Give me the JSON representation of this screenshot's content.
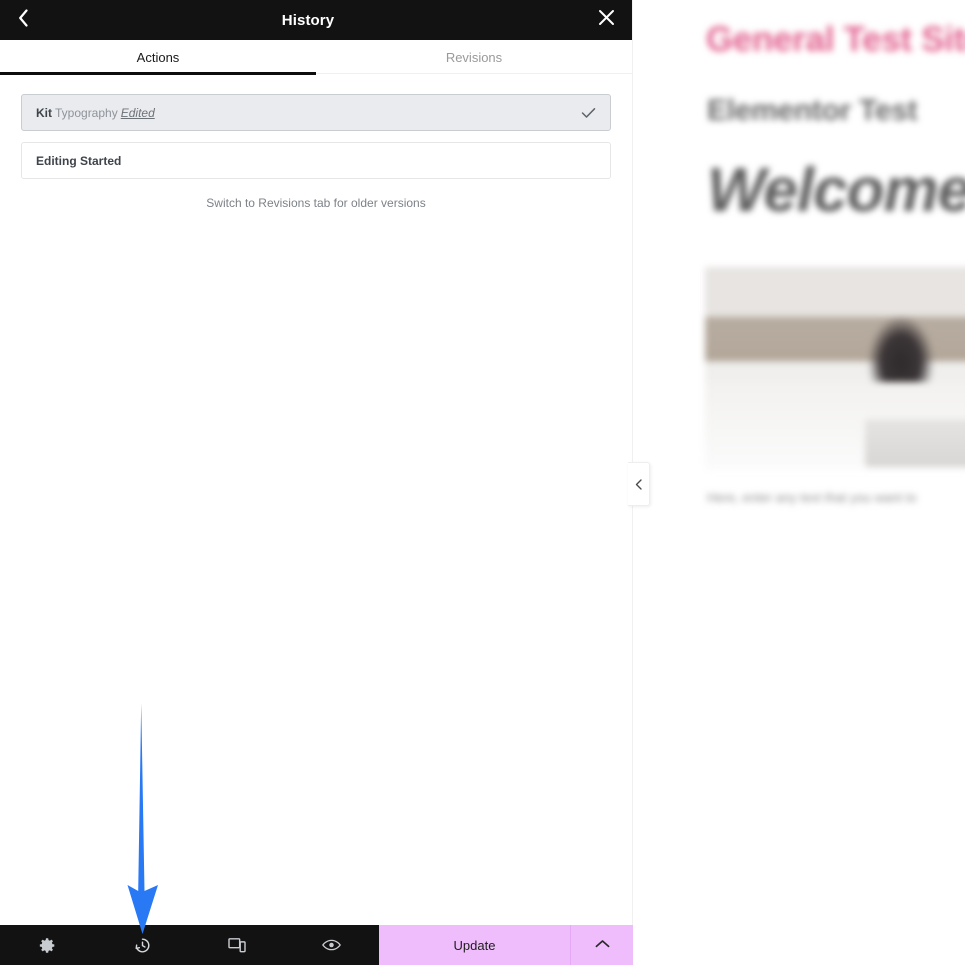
{
  "panel": {
    "title": "History",
    "back_icon": "chevron-left-icon",
    "close_icon": "close-icon",
    "tabs": [
      {
        "label": "Actions",
        "active": true
      },
      {
        "label": "Revisions",
        "active": false
      }
    ],
    "history_items": [
      {
        "title": "Kit",
        "subtitle": "Typography",
        "status": "Edited",
        "current": true,
        "check_icon": "check-icon"
      },
      {
        "title": "Editing Started",
        "subtitle": "",
        "status": "",
        "current": false,
        "check_icon": ""
      }
    ],
    "note": "Switch to Revisions tab for older versions"
  },
  "footer": {
    "tools": [
      {
        "name": "settings-icon"
      },
      {
        "name": "history-icon"
      },
      {
        "name": "responsive-mode-icon"
      },
      {
        "name": "preview-icon"
      }
    ],
    "update_label": "Update",
    "caret_icon": "chevron-up-icon"
  },
  "preview": {
    "site_title": "General Test Site",
    "sub_title": "Elementor Test",
    "welcome_heading": "Welcome",
    "body_text": "Here, enter any text that you want to",
    "collapse_icon": "chevron-left-icon"
  },
  "annotation": {
    "arrow": "down-arrow-pointer",
    "color": "#2979f5"
  },
  "colors": {
    "panel_header_bg": "#121212",
    "update_bg": "#efbdfb",
    "tab_active_underline": "#0d0d0d",
    "current_item_bg": "#e9ebee",
    "site_title_pink": "#e2628f",
    "arrow_blue": "#2979f5"
  }
}
